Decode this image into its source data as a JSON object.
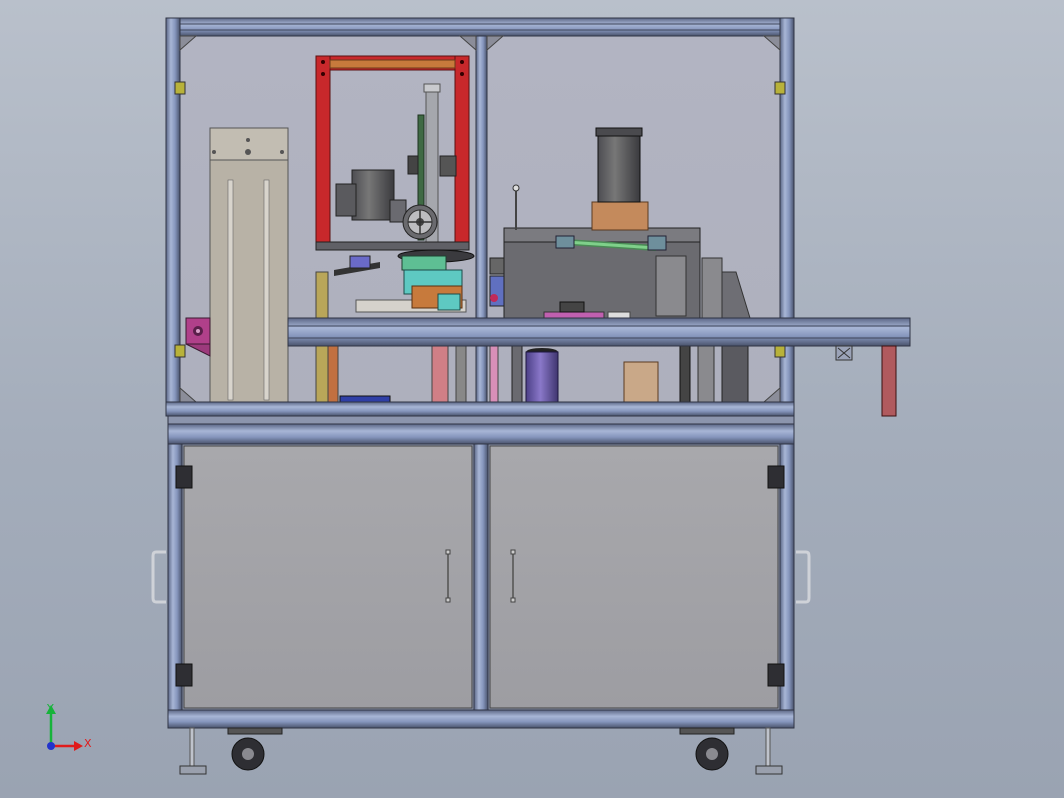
{
  "viewport": {
    "background_top": "#b9c0cb",
    "background_bottom": "#9aa3b2"
  },
  "triad": {
    "x_label": "X",
    "y_label": "Y",
    "x_color": "#e11b1b",
    "y_color": "#17b33a",
    "z_color": "#2233cc"
  },
  "colors": {
    "profile": "#8f9fc4",
    "profile_dark": "#42475a",
    "glass": "#b7b9c5",
    "cabinet_panel": "#a2a2a6",
    "red_frame": "#c8282b",
    "wood": "#c08a5a",
    "motor": "#3c3c40",
    "teal": "#5ec9c2",
    "purple": "#6a57a8",
    "magenta": "#b0408a",
    "green_gas_spring": "#7fd08a"
  }
}
